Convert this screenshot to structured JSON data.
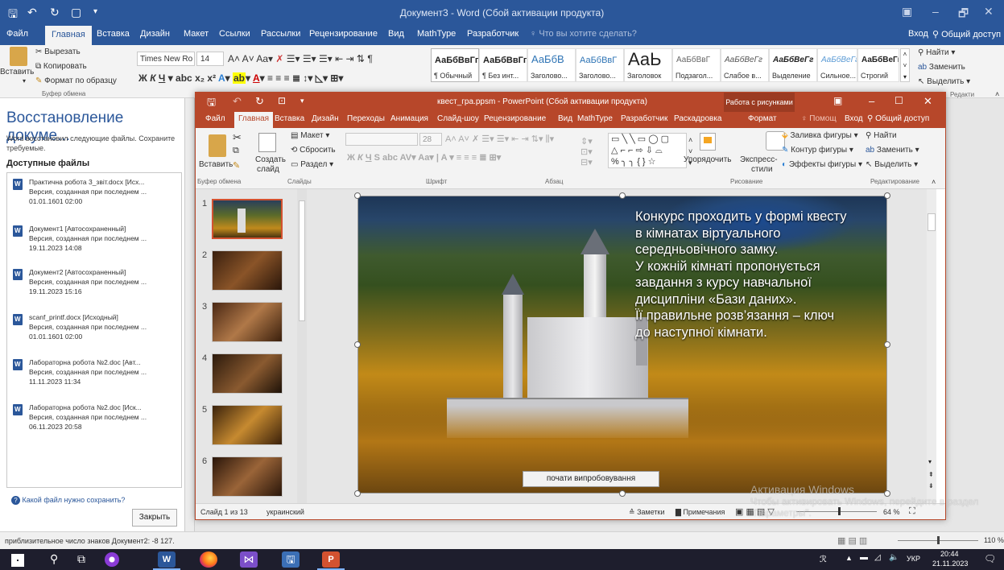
{
  "word": {
    "title": "Документ3 - Word (Сбой активации продукта)",
    "tabs": [
      "Файл",
      "Главная",
      "Вставка",
      "Дизайн",
      "Макет",
      "Ссылки",
      "Рассылки",
      "Рецензирование",
      "Вид",
      "MathType",
      "Разработчик"
    ],
    "tell_me": "Что вы хотите сделать?",
    "signin": "Вход",
    "share": "Общий доступ",
    "clipboard": {
      "cut": "Вырезать",
      "copy": "Копировать",
      "paste": "Вставить",
      "format": "Формат по образцу",
      "group": "Буфер обмена"
    },
    "font_name": "Times New Ro",
    "font_size": "14",
    "styles": [
      {
        "sample": "АаБбВвГг,",
        "name": "¶ Обычный"
      },
      {
        "sample": "АаБбВвГг,",
        "name": "¶ Без инт..."
      },
      {
        "sample": "АаБбВ",
        "name": "Заголово..."
      },
      {
        "sample": "АаБбВвГ",
        "name": "Заголово..."
      },
      {
        "sample": "АаЬ",
        "name": "Заголовок"
      },
      {
        "sample": "АаБбВвГ",
        "name": "Подзагол..."
      },
      {
        "sample": "АаБбВеГг",
        "name": "Слабое в..."
      },
      {
        "sample": "АаБбВеГг",
        "name": "Выделение"
      },
      {
        "sample": "АаБбВеГг",
        "name": "Сильное..."
      },
      {
        "sample": "АаБбВеГг",
        "name": "Строгий"
      }
    ],
    "editing": {
      "find": "Найти",
      "replace": "Заменить",
      "select": "Выделить"
    },
    "editing_group": "Редактирование",
    "status": "приблизительное число знаков Документ2: -8 127.",
    "zoom": "110 %"
  },
  "recovery": {
    "heading": "Восстановление докуме...",
    "intro": "Word восстановил следующие файлы. Сохраните требуемые.",
    "section": "Доступные файлы",
    "files": [
      {
        "name": "Практична робота 3_звіт.docx [Исх...",
        "desc": "Версия, созданная при последнем ...",
        "date": "01.01.1601 02:00"
      },
      {
        "name": "Документ1 [Автосохраненный]",
        "desc": "Версия, созданная при последнем ...",
        "date": "19.11.2023 14:08"
      },
      {
        "name": "Документ2 [Автосохраненный]",
        "desc": "Версия, созданная при последнем ...",
        "date": "19.11.2023 15:16"
      },
      {
        "name": "scanf_printf.docx [Исходный]",
        "desc": "Версия, созданная при последнем ...",
        "date": "01.01.1601 02:00"
      },
      {
        "name": "Лабораторна робота №2.doc [Авт...",
        "desc": "Версия, созданная при последнем ...",
        "date": "11.11.2023 11:34"
      },
      {
        "name": "Лабораторна робота №2.doc [Иск...",
        "desc": "Версия, созданная при последнем ...",
        "date": "06.11.2023 20:58"
      }
    ],
    "help": "Какой файл нужно сохранить?",
    "close": "Закрыть"
  },
  "ppt": {
    "title": "квест_гра.ppsm - PowerPoint (Сбой активации продукта)",
    "context_tab": "Работа с рисунками",
    "tabs": [
      "Файл",
      "Главная",
      "Вставка",
      "Дизайн",
      "Переходы",
      "Анимация",
      "Слайд-шоу",
      "Рецензирование",
      "Вид",
      "MathType",
      "Разработчик",
      "Раскадровка",
      "Формат"
    ],
    "help": "Помощ",
    "signin": "Вход",
    "share": "Общий доступ",
    "ribbon": {
      "paste": "Вставить",
      "create": "Создать",
      "slide": "слайд",
      "layout": "Макет",
      "reset": "Сбросить",
      "section": "Раздел",
      "font_size": "28",
      "arrange": "Упорядочить",
      "express": "Экспресс-",
      "styles": "стили",
      "fill": "Заливка фигуры",
      "outline": "Контур фигуры",
      "effects": "Эффекты фигуры",
      "find": "Найти",
      "replace": "Заменить",
      "select": "Выделить"
    },
    "groups": [
      "Буфер обмена",
      "Слайды",
      "Шрифт",
      "Абзац",
      "Рисование",
      "Редактирование"
    ],
    "slide_numbers": [
      "1",
      "2",
      "3",
      "4",
      "5",
      "6"
    ],
    "slide_text": [
      "Конкурс проходить у формі квесту",
      "в кімнатах віртуального",
      "середньовічного замку.",
      "У кожній кімнаті пропонується",
      "завдання з курсу навчальної",
      "дисципліни «Бази даних».",
      "Її правильне розв’язання – ключ",
      "до наступної кімнати."
    ],
    "slide_button": "почати випробовування",
    "status": {
      "slide": "Слайд 1 из 13",
      "lang": "украинский",
      "notes": "Заметки",
      "comments": "Примечания",
      "zoom": "64 %"
    }
  },
  "watermark": {
    "line1": "Активация Windows",
    "line2": "Чтобы активировать Windows, перейдите в раздел",
    "line3": "\"Параметры\"."
  },
  "taskbar": {
    "time": "20:44",
    "date": "21.11.2023",
    "lang": "УКР"
  }
}
